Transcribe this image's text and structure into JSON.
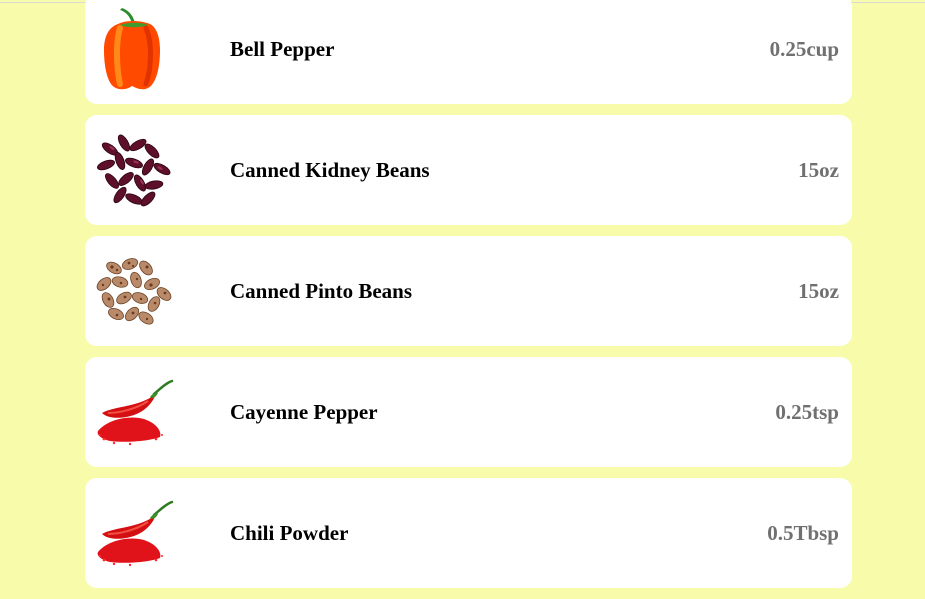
{
  "colors": {
    "page_background": "#f8fbaa",
    "card_background": "#ffffff",
    "name_text": "#000000",
    "quantity_text": "#707070"
  },
  "ingredients": [
    {
      "name": "Bell Pepper",
      "quantity": "0.25cup",
      "icon": "bell-pepper-icon"
    },
    {
      "name": "Canned Kidney Beans",
      "quantity": "15oz",
      "icon": "kidney-beans-icon"
    },
    {
      "name": "Canned Pinto Beans",
      "quantity": "15oz",
      "icon": "pinto-beans-icon"
    },
    {
      "name": "Cayenne Pepper",
      "quantity": "0.25tsp",
      "icon": "cayenne-pepper-icon"
    },
    {
      "name": "Chili Powder",
      "quantity": "0.5Tbsp",
      "icon": "chili-powder-icon"
    }
  ]
}
